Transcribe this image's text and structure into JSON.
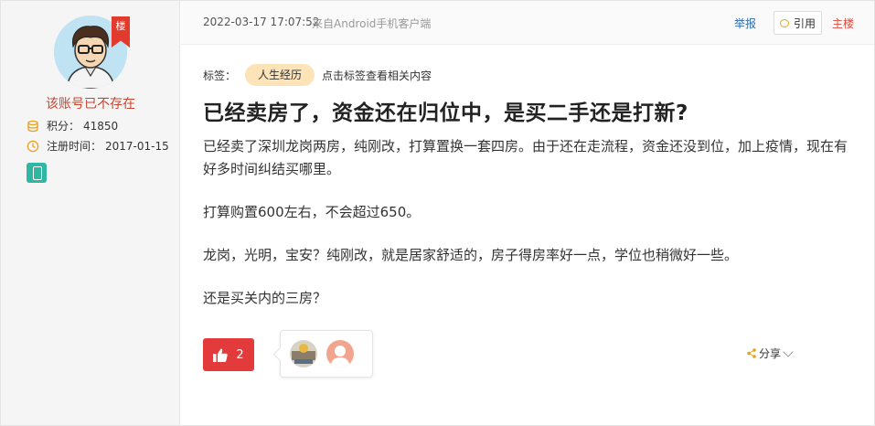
{
  "user": {
    "floor_badge": "楼",
    "username": "该账号已不存在",
    "points_label": "积分：",
    "points_value": "41850",
    "reg_label": "注册时间：",
    "reg_value": "2017-01-15",
    "icons": {
      "points": "coins-icon",
      "reg": "clock-icon",
      "mobile": "mobile-phone-icon"
    },
    "colors": {
      "username": "#c8462f",
      "badge": "#e23b2e",
      "mobile": "#2fb7a4"
    }
  },
  "post": {
    "timestamp": "2022-03-17 17:07:52",
    "source": "来自Android手机客户端",
    "report_label": "举报",
    "quote_label": "引用",
    "op_label": "主楼",
    "tag_label": "标签：",
    "tag": "人生经历",
    "tag_hint": "点击标签查看相关内容",
    "title": "已经卖房了，资金还在归位中，是买二手还是打新?",
    "paragraphs": [
      "已经卖了深圳龙岗两房，纯刚改，打算置换一套四房。由于还在走流程，资金还没到位，加上疫情，现在有好多时间纠结买哪里。",
      "打算购置600左右，不会超过650。",
      "龙岗，光明，宝安？纯刚改，就是居家舒适的，房子得房率好一点，学位也稍微好一些。",
      "还是买关内的三房？"
    ],
    "like_count": "2",
    "share_label": "分享",
    "colors": {
      "like": "#e33b3b",
      "link": "#2d6cb5",
      "op": "#e0473a",
      "tag_bg": "#fde3b8"
    }
  }
}
